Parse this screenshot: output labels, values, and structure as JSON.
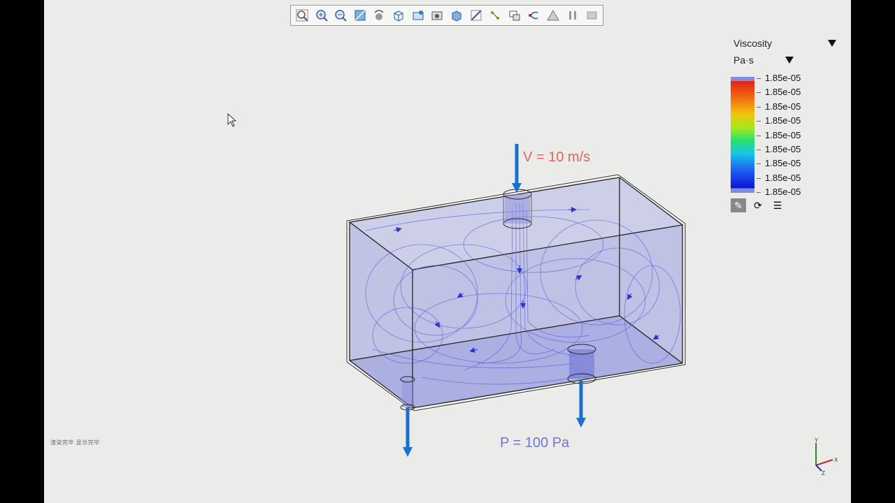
{
  "toolbar": {
    "buttons": [
      {
        "name": "zoom-fit-icon"
      },
      {
        "name": "zoom-in-icon"
      },
      {
        "name": "zoom-out-icon"
      },
      {
        "name": "zoom-box-icon"
      },
      {
        "name": "rotate-icon"
      },
      {
        "name": "view-cube-icon"
      },
      {
        "name": "view-orient-icon"
      },
      {
        "name": "screenshot-icon"
      },
      {
        "name": "display-style-icon"
      },
      {
        "name": "section-icon"
      },
      {
        "name": "probe-icon"
      },
      {
        "name": "render-options-icon"
      },
      {
        "name": "streamline-icon"
      },
      {
        "name": "mesh-icon"
      },
      {
        "name": "pause-icon"
      },
      {
        "name": "stop-icon"
      }
    ]
  },
  "annotations": {
    "inlet_label": "V = 10 m/s",
    "outlet_label": "P = 100 Pa"
  },
  "legend": {
    "quantity": "Viscosity",
    "unit": "Pa·s",
    "values": [
      "1.85e-05",
      "1.85e-05",
      "1.85e-05",
      "1.85e-05",
      "1.85e-05",
      "1.85e-05",
      "1.85e-05",
      "1.85e-05",
      "1.85e-05"
    ]
  },
  "status": {
    "text": "渲染完毕 显示完毕"
  },
  "colors": {
    "inlet": "#e8655a",
    "outlet": "#6f74d8",
    "arrow": "#1a6fd0",
    "fluid": "#8d90dc"
  }
}
